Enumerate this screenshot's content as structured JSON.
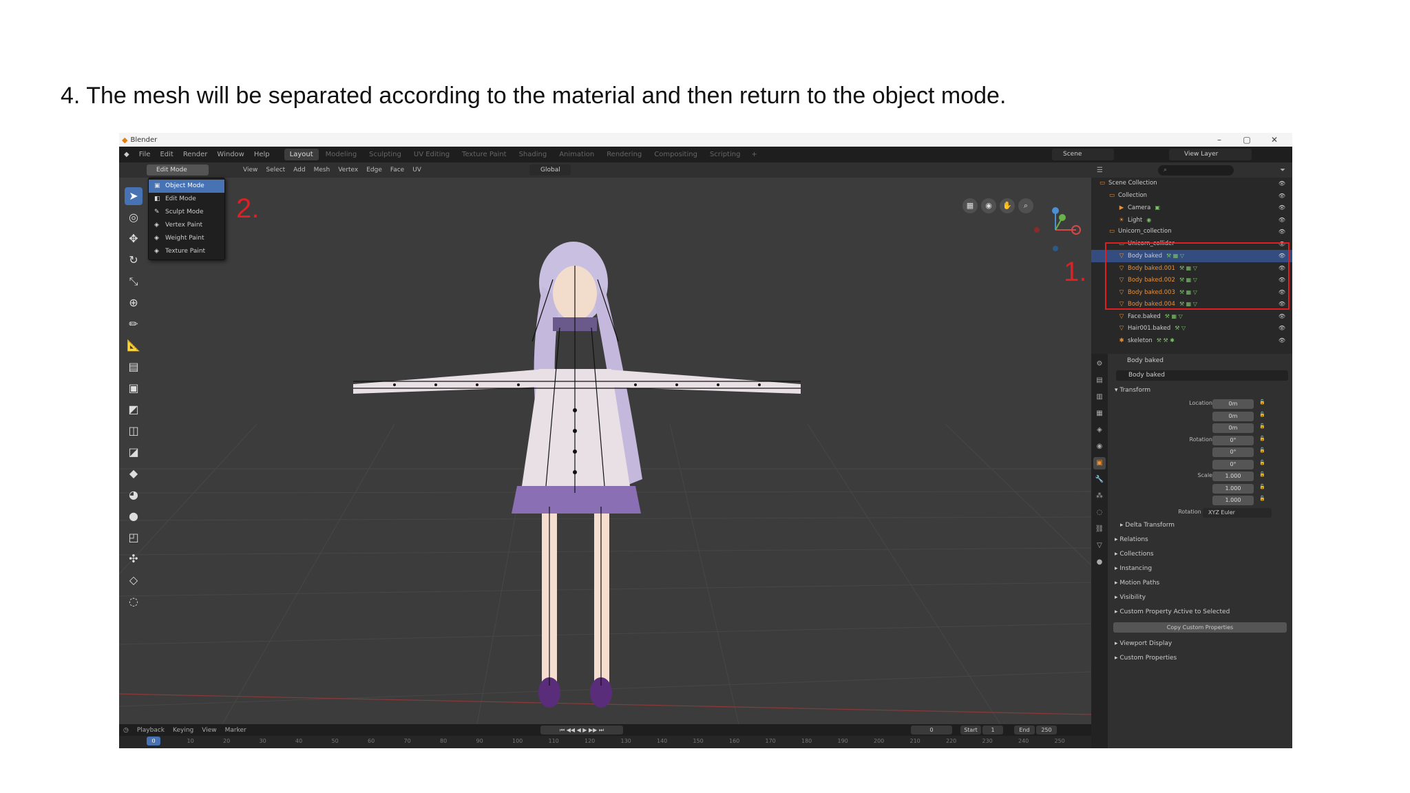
{
  "caption": "4. The mesh will be separated according to the material and then return to the object mode.",
  "window": {
    "title": "Blender",
    "minimize_icon": "minimize-icon",
    "maximize_icon": "maximize-icon",
    "close_icon": "close-icon",
    "min_glyph": "–",
    "max_glyph": "▢",
    "close_glyph": "✕"
  },
  "menubar": {
    "items": [
      "File",
      "Edit",
      "Render",
      "Window",
      "Help"
    ],
    "workspaces": [
      "Layout",
      "Modeling",
      "Sculpting",
      "UV Editing",
      "Texture Paint",
      "Shading",
      "Animation",
      "Rendering",
      "Compositing",
      "Scripting"
    ],
    "active_workspace": "Layout",
    "add_tab": "+",
    "scene": "Scene",
    "view_layer": "View Layer"
  },
  "viewport_header": {
    "mode": "Edit Mode",
    "menus": [
      "View",
      "Select",
      "Add",
      "Mesh",
      "Vertex",
      "Edge",
      "Face",
      "UV"
    ],
    "orientation": "Global"
  },
  "mode_menu": {
    "items": [
      {
        "label": "Object Mode",
        "icon": "object-mode-icon",
        "glyph": "▣",
        "active": true
      },
      {
        "label": "Edit Mode",
        "icon": "edit-mode-icon",
        "glyph": "◧",
        "active": false
      },
      {
        "label": "Sculpt Mode",
        "icon": "sculpt-mode-icon",
        "glyph": "✎",
        "active": false
      },
      {
        "label": "Vertex Paint",
        "icon": "vertex-paint-icon",
        "glyph": "◈",
        "active": false
      },
      {
        "label": "Weight Paint",
        "icon": "weight-paint-icon",
        "glyph": "◈",
        "active": false
      },
      {
        "label": "Texture Paint",
        "icon": "texture-paint-icon",
        "glyph": "◈",
        "active": false
      }
    ]
  },
  "annotations": {
    "one": "1.",
    "two": "2."
  },
  "toolbar": {
    "tools": [
      {
        "name": "select-tool-icon",
        "glyph": "➤",
        "active": true
      },
      {
        "name": "cursor-tool-icon",
        "glyph": "◎",
        "active": false
      },
      {
        "name": "move-tool-icon",
        "glyph": "✥",
        "active": false
      },
      {
        "name": "rotate-tool-icon",
        "glyph": "↻",
        "active": false
      },
      {
        "name": "scale-tool-icon",
        "glyph": "⤡",
        "active": false
      },
      {
        "name": "transform-tool-icon",
        "glyph": "⊕",
        "active": false
      },
      {
        "name": "annotate-tool-icon",
        "glyph": "✏",
        "active": false
      },
      {
        "name": "measure-tool-icon",
        "glyph": "📐",
        "active": false
      },
      {
        "name": "extrude-tool-icon",
        "glyph": "▤",
        "active": false
      },
      {
        "name": "inset-tool-icon",
        "glyph": "▣",
        "active": false
      },
      {
        "name": "bevel-tool-icon",
        "glyph": "◩",
        "active": false
      },
      {
        "name": "loop-cut-tool-icon",
        "glyph": "◫",
        "active": false
      },
      {
        "name": "knife-tool-icon",
        "glyph": "◪",
        "active": false
      },
      {
        "name": "poly-build-tool-icon",
        "glyph": "◆",
        "active": false
      },
      {
        "name": "spin-tool-icon",
        "glyph": "◕",
        "active": false
      },
      {
        "name": "smooth-tool-icon",
        "glyph": "●",
        "active": false
      },
      {
        "name": "edge-slide-tool-icon",
        "glyph": "◰",
        "active": false
      },
      {
        "name": "shrink-tool-icon",
        "glyph": "✣",
        "active": false
      },
      {
        "name": "shear-tool-icon",
        "glyph": "◇",
        "active": false
      },
      {
        "name": "rip-tool-icon",
        "glyph": "◌",
        "active": false
      }
    ]
  },
  "viewport_nav": {
    "buttons": [
      {
        "name": "toggle-camera-icon",
        "glyph": "▦"
      },
      {
        "name": "camera-view-icon",
        "glyph": "◉"
      },
      {
        "name": "pan-hand-icon",
        "glyph": "✋"
      },
      {
        "name": "zoom-icon",
        "glyph": "⌕"
      }
    ]
  },
  "timeline": {
    "menus": [
      "Playback",
      "Keying",
      "View",
      "Marker"
    ],
    "current_frame": "0",
    "start_label": "Start",
    "start": "1",
    "end_label": "End",
    "end": "250",
    "frame_marker": "0",
    "ticks": [
      "0",
      "10",
      "20",
      "30",
      "40",
      "50",
      "60",
      "70",
      "80",
      "90",
      "100",
      "110",
      "120",
      "130",
      "140",
      "150",
      "160",
      "170",
      "180",
      "190",
      "200",
      "210",
      "220",
      "230",
      "240",
      "250"
    ]
  },
  "outliner": {
    "rows": [
      {
        "indent": 0,
        "icon": "scene-collection-icon",
        "glyph": "▭",
        "label": "Scene Collection",
        "selected": false,
        "orange": false,
        "extra": ""
      },
      {
        "indent": 1,
        "icon": "collection-icon",
        "glyph": "▭",
        "label": "Collection",
        "selected": false,
        "orange": false,
        "extra": ""
      },
      {
        "indent": 2,
        "icon": "camera-icon",
        "glyph": "▶",
        "label": "Camera",
        "selected": false,
        "orange": false,
        "extra": "▣"
      },
      {
        "indent": 2,
        "icon": "light-icon",
        "glyph": "☀",
        "label": "Light",
        "selected": false,
        "orange": false,
        "extra": "◉"
      },
      {
        "indent": 1,
        "icon": "collection-icon",
        "glyph": "▭",
        "label": "Unicorn_collection",
        "selected": false,
        "orange": false,
        "extra": ""
      },
      {
        "indent": 2,
        "icon": "collection-icon",
        "glyph": "▭",
        "label": "Unicorn_collider",
        "selected": false,
        "orange": false,
        "extra": ""
      },
      {
        "indent": 2,
        "icon": "mesh-icon",
        "glyph": "▽",
        "label": "Body baked",
        "selected": true,
        "orange": false,
        "extra": "⚒ ▦ ▽"
      },
      {
        "indent": 2,
        "icon": "mesh-icon",
        "glyph": "▽",
        "label": "Body baked.001",
        "selected": false,
        "orange": true,
        "extra": "⚒ ▦ ▽"
      },
      {
        "indent": 2,
        "icon": "mesh-icon",
        "glyph": "▽",
        "label": "Body baked.002",
        "selected": false,
        "orange": true,
        "extra": "⚒ ▦ ▽"
      },
      {
        "indent": 2,
        "icon": "mesh-icon",
        "glyph": "▽",
        "label": "Body baked.003",
        "selected": false,
        "orange": true,
        "extra": "⚒ ▦ ▽"
      },
      {
        "indent": 2,
        "icon": "mesh-icon",
        "glyph": "▽",
        "label": "Body baked.004",
        "selected": false,
        "orange": true,
        "extra": "⚒ ▦ ▽"
      },
      {
        "indent": 2,
        "icon": "mesh-icon",
        "glyph": "▽",
        "label": "Face.baked",
        "selected": false,
        "orange": false,
        "extra": "⚒ ▦ ▽"
      },
      {
        "indent": 2,
        "icon": "mesh-icon",
        "glyph": "▽",
        "label": "Hair001.baked",
        "selected": false,
        "orange": false,
        "extra": "⚒ ▽"
      },
      {
        "indent": 2,
        "icon": "armature-icon",
        "glyph": "✱",
        "label": "skeleton",
        "selected": false,
        "orange": false,
        "extra": "⚒ ⚒ ✱"
      }
    ],
    "search_placeholder": "⌕"
  },
  "properties": {
    "object_name": "Body baked",
    "name_field": "Body baked",
    "transform_title": "Transform",
    "location_label": "Location X",
    "location": [
      "0m",
      "0m",
      "0m"
    ],
    "rotation_label": "Rotation X",
    "rotation": [
      "0°",
      "0°",
      "0°"
    ],
    "scale_label": "Scale X",
    "scale": [
      "1.000",
      "1.000",
      "1.000"
    ],
    "axis_y": "Y",
    "axis_z": "Z",
    "rotation_mode_label": "Rotation Mode",
    "rotation_mode": "XYZ Euler",
    "delta_transform": "Delta Transform",
    "panels": [
      "Relations",
      "Collections",
      "Instancing",
      "Motion Paths",
      "Visibility",
      "Custom Property Active to Selected"
    ],
    "copy_button": "Copy Custom Properties",
    "panels2": [
      "Viewport Display",
      "Custom Properties"
    ]
  },
  "colors": {
    "accent": "#4772b3",
    "annotation": "#e02020",
    "orange": "#e8913a"
  }
}
